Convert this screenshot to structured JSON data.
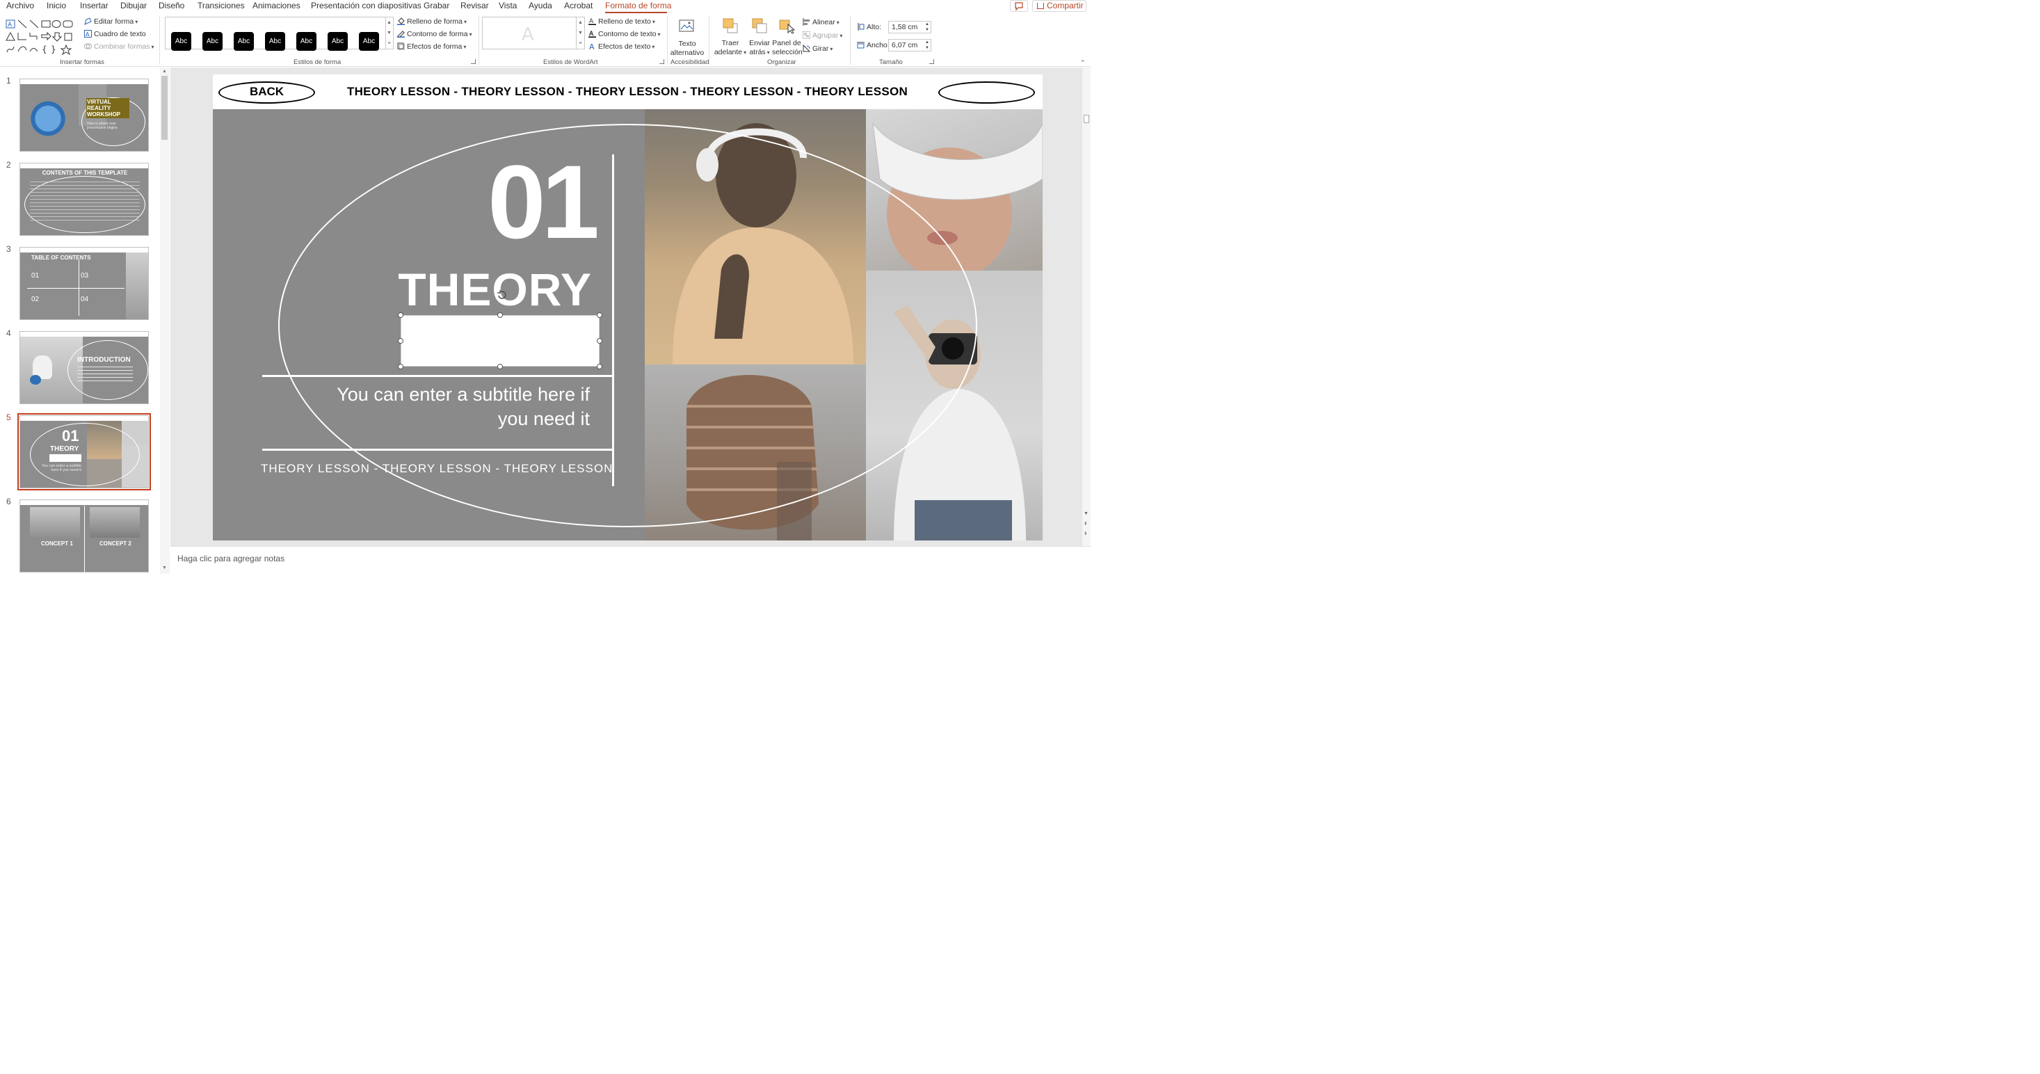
{
  "menu": {
    "tabs": [
      "Archivo",
      "Inicio",
      "Insertar",
      "Dibujar",
      "Diseño",
      "Transiciones",
      "Animaciones",
      "Presentación con diapositivas",
      "Grabar",
      "Revisar",
      "Vista",
      "Ayuda",
      "Acrobat",
      "Formato de forma"
    ],
    "active_tab": "Formato de forma",
    "share_label": "Compartir"
  },
  "ribbon": {
    "insertar_formas": {
      "label": "Insertar formas",
      "edit_shape": "Editar forma",
      "text_box": "Cuadro de texto",
      "merge_shapes": "Combinar formas"
    },
    "estilos_forma": {
      "label": "Estilos de forma",
      "style_sample": "Abc",
      "fill": "Relleno de forma",
      "outline": "Contorno de forma",
      "effects": "Efectos de forma"
    },
    "wordart": {
      "label": "Estilos de WordArt",
      "sample_letter": "A",
      "text_fill": "Relleno de texto",
      "text_outline": "Contorno de texto",
      "text_effects": "Efectos de texto"
    },
    "accesibilidad": {
      "label": "Accesibilidad",
      "alt_text_line1": "Texto",
      "alt_text_line2": "alternativo"
    },
    "organizar": {
      "label": "Organizar",
      "bring_forward_1": "Traer",
      "bring_forward_2": "adelante",
      "send_back_1": "Enviar",
      "send_back_2": "atrás",
      "selection_1": "Panel de",
      "selection_2": "selección",
      "align": "Alinear",
      "group": "Agrupar",
      "rotate": "Girar"
    },
    "tamano": {
      "label": "Tamaño",
      "height_label": "Alto:",
      "height_value": "1,58 cm",
      "width_label": "Ancho:",
      "width_value": "6,07 cm"
    }
  },
  "thumbnails": [
    {
      "num": "1",
      "title": "VIRTUAL REALITY WORKSHOP",
      "sub": "Here is where your presentation begins"
    },
    {
      "num": "2",
      "title": "CONTENTS OF THIS TEMPLATE"
    },
    {
      "num": "3",
      "title": "TABLE OF CONTENTS",
      "items": [
        "01",
        "02",
        "03",
        "04"
      ]
    },
    {
      "num": "4",
      "title": "INTRODUCTION"
    },
    {
      "num": "5",
      "title": "THEORY",
      "number": "01",
      "sub": "You can enter a subtitle here if you need it"
    },
    {
      "num": "6",
      "titles": [
        "CONCEPT 1",
        "CONCEPT 2"
      ]
    }
  ],
  "slide": {
    "back_label": "BACK",
    "top_marquee": "THEORY LESSON - THEORY LESSON - THEORY LESSON - THEORY LESSON - THEORY LESSON",
    "number": "01",
    "title": "THEORY",
    "subtitle": "You can enter a subtitle here if you need it",
    "bottom_marquee": "THEORY LESSON - THEORY LESSON - THEORY LESSON"
  },
  "notes": {
    "placeholder": "Haga clic para agregar notas"
  },
  "colors": {
    "accent": "#b7472a",
    "slide_bg": "#8a8a8a",
    "ribbon_bg": "#ffffff"
  }
}
